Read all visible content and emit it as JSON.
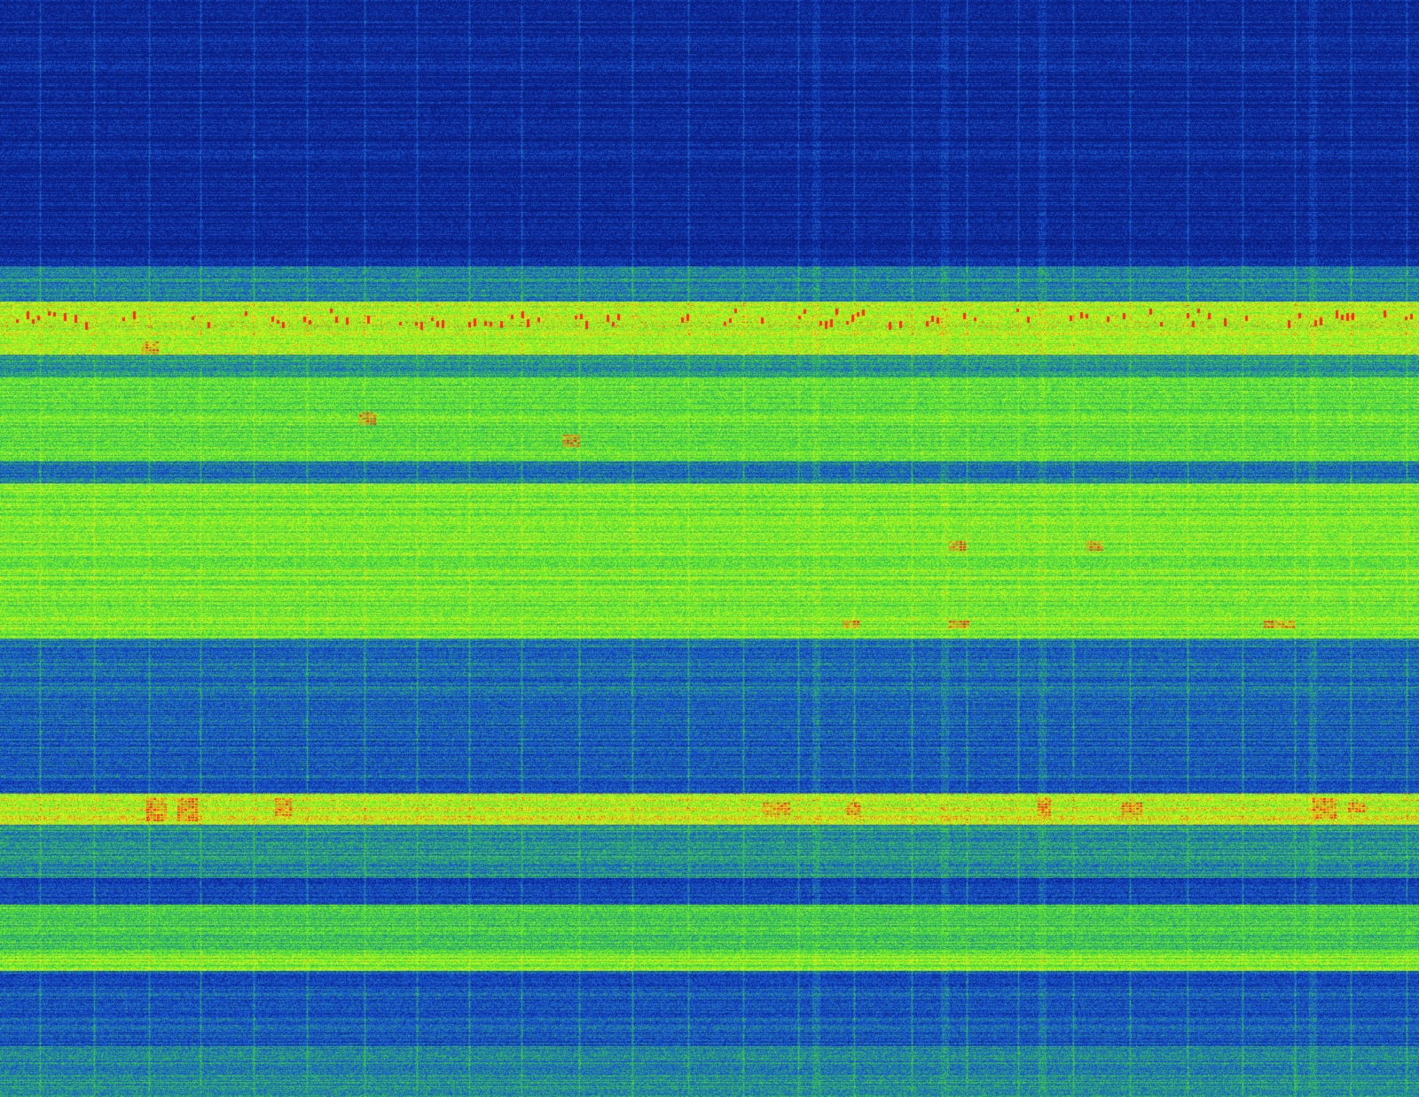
{
  "display": {
    "type": "waterfall-spectrogram",
    "palette": {
      "background": "#0b1a6b",
      "low": "#0a1f8a",
      "mid_low": "#1a5cd6",
      "mid": "#2fb85a",
      "mid_high": "#6cf02a",
      "high": "#e6f21a",
      "peak": "#ff1a1a"
    },
    "text": []
  }
}
